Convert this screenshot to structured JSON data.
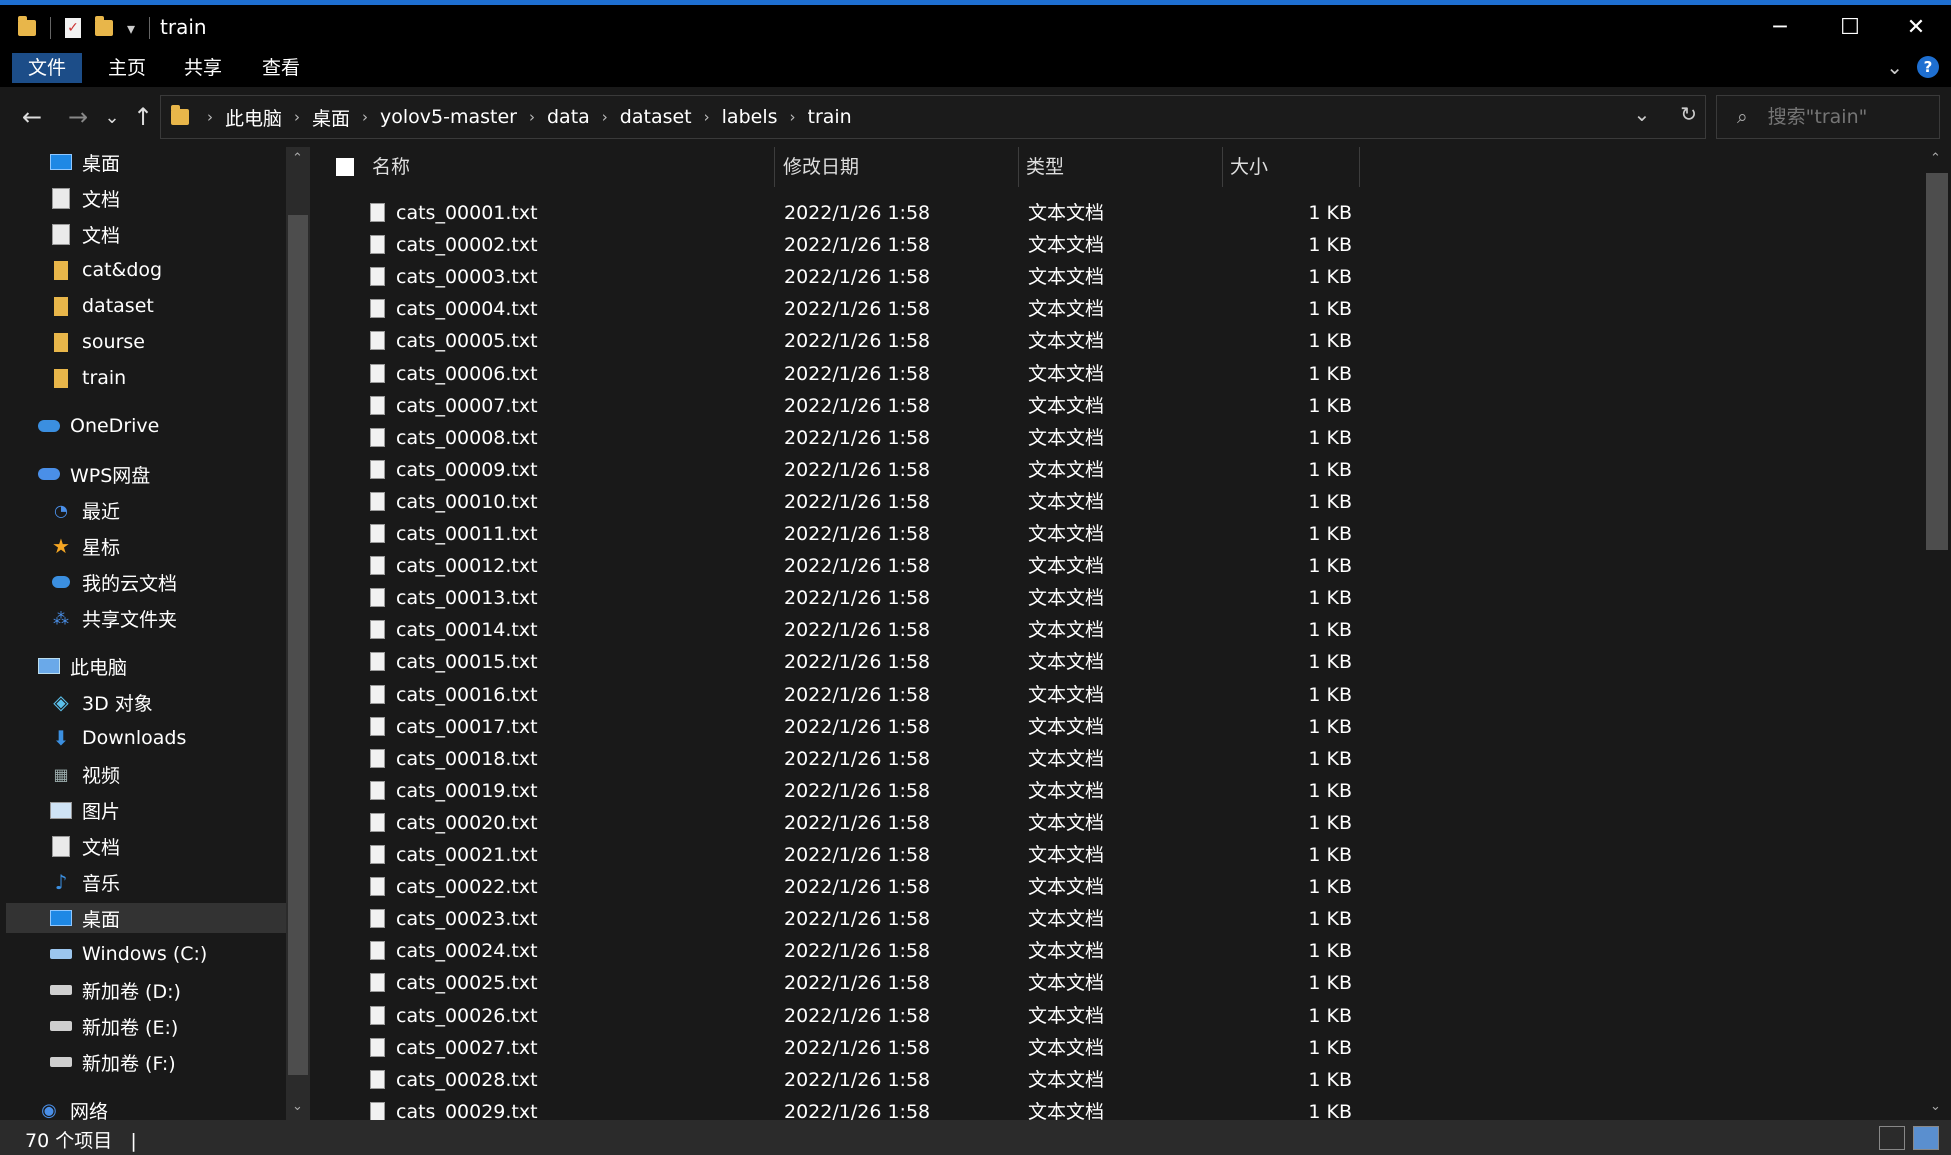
{
  "window": {
    "title": "train",
    "min_glyph": "─",
    "max_glyph": "☐",
    "close_glyph": "✕",
    "quick_access_more": "▾"
  },
  "ribbon": {
    "tabs": [
      "文件",
      "主页",
      "共享",
      "查看"
    ],
    "expand_glyph": "⌄",
    "help_glyph": "?"
  },
  "nav": {
    "back": "←",
    "forward": "→",
    "recent": "⌄",
    "up": "↑",
    "breadcrumb": [
      "此电脑",
      "桌面",
      "yolov5-master",
      "data",
      "dataset",
      "labels",
      "train"
    ],
    "chevron": "›",
    "dropdown_glyph": "⌄",
    "refresh_glyph": "↻",
    "search_icon": "⌕",
    "search_placeholder": "搜索\"train\""
  },
  "navpane": {
    "items": [
      {
        "label": "桌面",
        "icon": "desktop-icon",
        "pinned": true
      },
      {
        "label": "文档",
        "icon": "document-icon",
        "pinned": true
      },
      {
        "label": "文档",
        "icon": "document-icon",
        "pinned": true
      },
      {
        "label": "cat&dog",
        "icon": "folder-icon"
      },
      {
        "label": "dataset",
        "icon": "folder-icon"
      },
      {
        "label": "sourse",
        "icon": "folder-icon"
      },
      {
        "label": "train",
        "icon": "folder-icon"
      },
      {
        "label": "OneDrive",
        "icon": "cloud-icon"
      },
      {
        "label": "WPS网盘",
        "icon": "cloud-icon"
      },
      {
        "label": "最近",
        "icon": "clock-icon"
      },
      {
        "label": "星标",
        "icon": "star-icon"
      },
      {
        "label": "我的云文档",
        "icon": "cloud-icon"
      },
      {
        "label": "共享文件夹",
        "icon": "share-icon"
      },
      {
        "label": "此电脑",
        "icon": "computer-icon"
      },
      {
        "label": "3D 对象",
        "icon": "cube-icon"
      },
      {
        "label": "Downloads",
        "icon": "download-icon"
      },
      {
        "label": "视频",
        "icon": "video-icon"
      },
      {
        "label": "图片",
        "icon": "picture-icon"
      },
      {
        "label": "文档",
        "icon": "document-icon"
      },
      {
        "label": "音乐",
        "icon": "music-icon"
      },
      {
        "label": "桌面",
        "icon": "desktop-icon",
        "selected": true
      },
      {
        "label": "Windows (C:)",
        "icon": "drive-icon"
      },
      {
        "label": "新加卷 (D:)",
        "icon": "drive-icon"
      },
      {
        "label": "新加卷 (E:)",
        "icon": "drive-icon"
      },
      {
        "label": "新加卷 (F:)",
        "icon": "drive-icon"
      },
      {
        "label": "网络",
        "icon": "network-icon"
      }
    ],
    "pin_glyph": "📌",
    "scroll_up": "⌃",
    "scroll_down": "⌄"
  },
  "columns": {
    "name": "名称",
    "modified": "修改日期",
    "type": "类型",
    "size": "大小",
    "sort_glyph": "⌃"
  },
  "files": [
    {
      "name": "cats_00001.txt",
      "modified": "2022/1/26 1:58",
      "type": "文本文档",
      "size": "1 KB"
    },
    {
      "name": "cats_00002.txt",
      "modified": "2022/1/26 1:58",
      "type": "文本文档",
      "size": "1 KB"
    },
    {
      "name": "cats_00003.txt",
      "modified": "2022/1/26 1:58",
      "type": "文本文档",
      "size": "1 KB"
    },
    {
      "name": "cats_00004.txt",
      "modified": "2022/1/26 1:58",
      "type": "文本文档",
      "size": "1 KB"
    },
    {
      "name": "cats_00005.txt",
      "modified": "2022/1/26 1:58",
      "type": "文本文档",
      "size": "1 KB"
    },
    {
      "name": "cats_00006.txt",
      "modified": "2022/1/26 1:58",
      "type": "文本文档",
      "size": "1 KB"
    },
    {
      "name": "cats_00007.txt",
      "modified": "2022/1/26 1:58",
      "type": "文本文档",
      "size": "1 KB"
    },
    {
      "name": "cats_00008.txt",
      "modified": "2022/1/26 1:58",
      "type": "文本文档",
      "size": "1 KB"
    },
    {
      "name": "cats_00009.txt",
      "modified": "2022/1/26 1:58",
      "type": "文本文档",
      "size": "1 KB"
    },
    {
      "name": "cats_00010.txt",
      "modified": "2022/1/26 1:58",
      "type": "文本文档",
      "size": "1 KB"
    },
    {
      "name": "cats_00011.txt",
      "modified": "2022/1/26 1:58",
      "type": "文本文档",
      "size": "1 KB"
    },
    {
      "name": "cats_00012.txt",
      "modified": "2022/1/26 1:58",
      "type": "文本文档",
      "size": "1 KB"
    },
    {
      "name": "cats_00013.txt",
      "modified": "2022/1/26 1:58",
      "type": "文本文档",
      "size": "1 KB"
    },
    {
      "name": "cats_00014.txt",
      "modified": "2022/1/26 1:58",
      "type": "文本文档",
      "size": "1 KB"
    },
    {
      "name": "cats_00015.txt",
      "modified": "2022/1/26 1:58",
      "type": "文本文档",
      "size": "1 KB"
    },
    {
      "name": "cats_00016.txt",
      "modified": "2022/1/26 1:58",
      "type": "文本文档",
      "size": "1 KB"
    },
    {
      "name": "cats_00017.txt",
      "modified": "2022/1/26 1:58",
      "type": "文本文档",
      "size": "1 KB"
    },
    {
      "name": "cats_00018.txt",
      "modified": "2022/1/26 1:58",
      "type": "文本文档",
      "size": "1 KB"
    },
    {
      "name": "cats_00019.txt",
      "modified": "2022/1/26 1:58",
      "type": "文本文档",
      "size": "1 KB"
    },
    {
      "name": "cats_00020.txt",
      "modified": "2022/1/26 1:58",
      "type": "文本文档",
      "size": "1 KB"
    },
    {
      "name": "cats_00021.txt",
      "modified": "2022/1/26 1:58",
      "type": "文本文档",
      "size": "1 KB"
    },
    {
      "name": "cats_00022.txt",
      "modified": "2022/1/26 1:58",
      "type": "文本文档",
      "size": "1 KB"
    },
    {
      "name": "cats_00023.txt",
      "modified": "2022/1/26 1:58",
      "type": "文本文档",
      "size": "1 KB"
    },
    {
      "name": "cats_00024.txt",
      "modified": "2022/1/26 1:58",
      "type": "文本文档",
      "size": "1 KB"
    },
    {
      "name": "cats_00025.txt",
      "modified": "2022/1/26 1:58",
      "type": "文本文档",
      "size": "1 KB"
    },
    {
      "name": "cats_00026.txt",
      "modified": "2022/1/26 1:58",
      "type": "文本文档",
      "size": "1 KB"
    },
    {
      "name": "cats_00027.txt",
      "modified": "2022/1/26 1:58",
      "type": "文本文档",
      "size": "1 KB"
    },
    {
      "name": "cats_00028.txt",
      "modified": "2022/1/26 1:58",
      "type": "文本文档",
      "size": "1 KB"
    },
    {
      "name": "cats_00029.txt",
      "modified": "2022/1/26 1:58",
      "type": "文本文档",
      "size": "1 KB"
    }
  ],
  "status": {
    "item_count": "70 个项目",
    "cursor": "|"
  },
  "colors": {
    "accent": "#1e6fd1",
    "file_tab": "#1c4d88",
    "background": "#191919"
  }
}
